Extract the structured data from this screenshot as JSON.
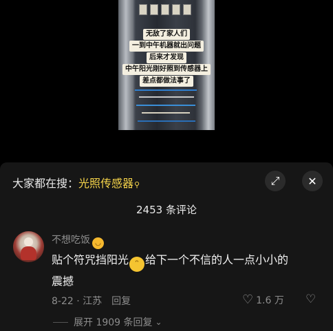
{
  "video": {
    "captions": [
      "无敌了家人们",
      "一到中午机器就出问题",
      "后来才发现",
      "中午阳光刚好照到传感器上",
      "差点都做法事了"
    ]
  },
  "search": {
    "prefix": "大家都在搜：",
    "term": "光照传感器",
    "glyph": "search-icon"
  },
  "toolbar": {
    "expand_icon": "expand-icon",
    "close_icon": "close-icon"
  },
  "comments_header": {
    "title": "2453 条评论"
  },
  "comment": {
    "username": "不想吃饭",
    "text_part1": "贴个符咒挡阳光",
    "text_part2": "给下一个不信的人一点小小的震撼",
    "date_location": "8-22 · 江苏",
    "reply_label": "回复",
    "likes": "1.6 万",
    "expand_replies": "展开 1909 条回复"
  },
  "colors": {
    "accent": "#f7d54a",
    "panel_bg": "#161616"
  }
}
